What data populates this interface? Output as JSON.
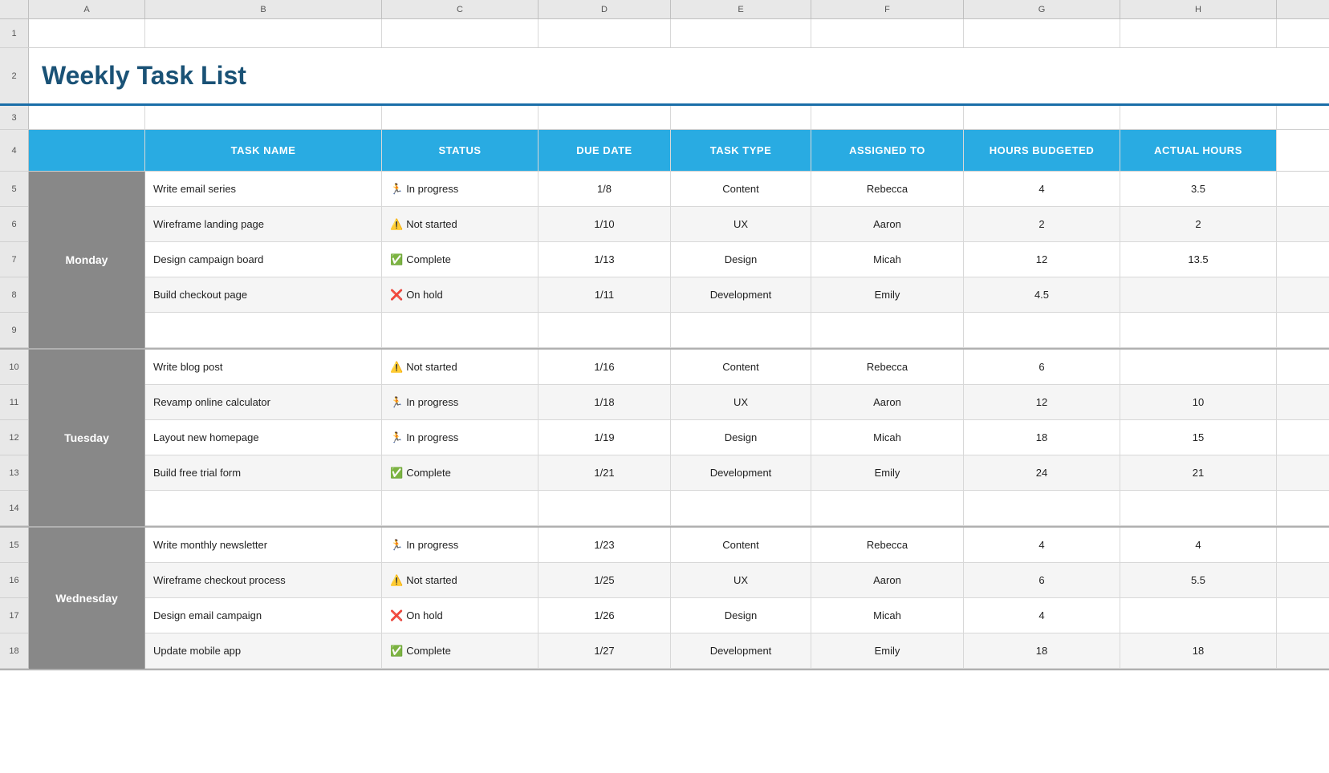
{
  "title": "Weekly Task List",
  "col_headers": [
    "A",
    "B",
    "C",
    "D",
    "E",
    "F",
    "G",
    "H"
  ],
  "table_headers": {
    "task_name": "TASK NAME",
    "status": "STATUS",
    "due_date": "DUE DATE",
    "task_type": "TASK TYPE",
    "assigned_to": "ASSIGNED TO",
    "hours_budgeted": "HOURS BUDGETED",
    "actual_hours": "ACTUAL HOURS"
  },
  "days": [
    {
      "day": "Monday",
      "rows": [
        {
          "row_num": "5",
          "task": "Write email series",
          "status_icon": "🏃",
          "status": "In progress",
          "due": "1/8",
          "type": "Content",
          "assigned": "Rebecca",
          "budgeted": "4",
          "actual": "3.5"
        },
        {
          "row_num": "6",
          "task": "Wireframe landing page",
          "status_icon": "⚠️",
          "status": "Not started",
          "due": "1/10",
          "type": "UX",
          "assigned": "Aaron",
          "budgeted": "2",
          "actual": "2"
        },
        {
          "row_num": "7",
          "task": "Design campaign board",
          "status_icon": "✅",
          "status": "Complete",
          "due": "1/13",
          "type": "Design",
          "assigned": "Micah",
          "budgeted": "12",
          "actual": "13.5"
        },
        {
          "row_num": "8",
          "task": "Build checkout page",
          "status_icon": "❌",
          "status": "On hold",
          "due": "1/11",
          "type": "Development",
          "assigned": "Emily",
          "budgeted": "4.5",
          "actual": ""
        },
        {
          "row_num": "9",
          "task": "",
          "status_icon": "",
          "status": "",
          "due": "",
          "type": "",
          "assigned": "",
          "budgeted": "",
          "actual": ""
        }
      ]
    },
    {
      "day": "Tuesday",
      "rows": [
        {
          "row_num": "10",
          "task": "Write blog post",
          "status_icon": "⚠️",
          "status": "Not started",
          "due": "1/16",
          "type": "Content",
          "assigned": "Rebecca",
          "budgeted": "6",
          "actual": ""
        },
        {
          "row_num": "11",
          "task": "Revamp online calculator",
          "status_icon": "🏃",
          "status": "In progress",
          "due": "1/18",
          "type": "UX",
          "assigned": "Aaron",
          "budgeted": "12",
          "actual": "10"
        },
        {
          "row_num": "12",
          "task": "Layout new homepage",
          "status_icon": "🏃",
          "status": "In progress",
          "due": "1/19",
          "type": "Design",
          "assigned": "Micah",
          "budgeted": "18",
          "actual": "15"
        },
        {
          "row_num": "13",
          "task": "Build free trial form",
          "status_icon": "✅",
          "status": "Complete",
          "due": "1/21",
          "type": "Development",
          "assigned": "Emily",
          "budgeted": "24",
          "actual": "21"
        },
        {
          "row_num": "14",
          "task": "",
          "status_icon": "",
          "status": "",
          "due": "",
          "type": "",
          "assigned": "",
          "budgeted": "",
          "actual": ""
        }
      ]
    },
    {
      "day": "Wednesday",
      "rows": [
        {
          "row_num": "15",
          "task": "Write monthly newsletter",
          "status_icon": "🏃",
          "status": "In progress",
          "due": "1/23",
          "type": "Content",
          "assigned": "Rebecca",
          "budgeted": "4",
          "actual": "4"
        },
        {
          "row_num": "16",
          "task": "Wireframe checkout process",
          "status_icon": "⚠️",
          "status": "Not started",
          "due": "1/25",
          "type": "UX",
          "assigned": "Aaron",
          "budgeted": "6",
          "actual": "5.5"
        },
        {
          "row_num": "17",
          "task": "Design email campaign",
          "status_icon": "❌",
          "status": "On hold",
          "due": "1/26",
          "type": "Design",
          "assigned": "Micah",
          "budgeted": "4",
          "actual": ""
        },
        {
          "row_num": "18",
          "task": "Update mobile app",
          "status_icon": "✅",
          "status": "Complete",
          "due": "1/27",
          "type": "Development",
          "assigned": "Emily",
          "budgeted": "18",
          "actual": "18"
        }
      ]
    }
  ]
}
